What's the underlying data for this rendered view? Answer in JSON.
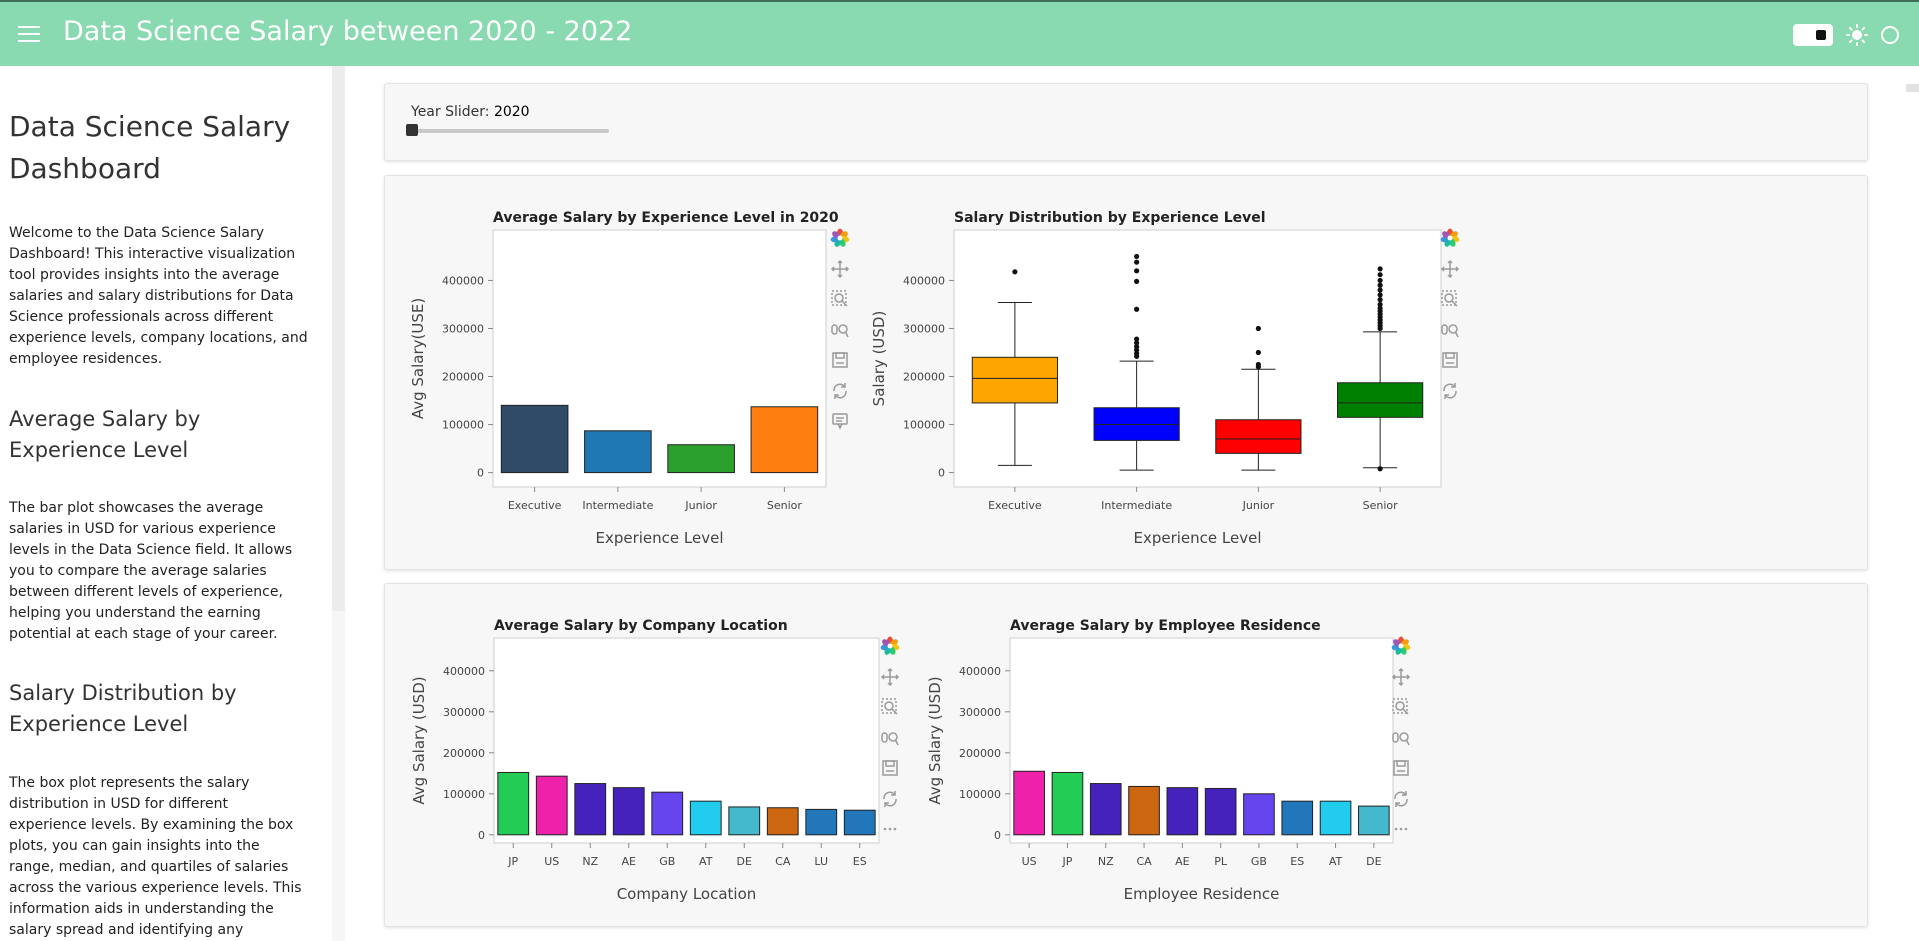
{
  "header": {
    "title": "Data Science Salary between 2020 - 2022",
    "bg_color": "#89dab0",
    "menu_icon": "hamburger-icon",
    "theme_icons": [
      "toggle-icon",
      "sun-icon",
      "circle-icon"
    ]
  },
  "sidebar": {
    "title": "Data Science Salary Dashboard",
    "intro": "Welcome to the Data Science Salary Dashboard! This interactive visualization tool provides insights into the average salaries and salary distributions for Data Science professionals across different experience levels, company locations, and employee residences.",
    "sections": [
      {
        "heading": "Average Salary by Experience Level",
        "text": "The bar plot showcases the average salaries in USD for various experience levels in the Data Science field. It allows you to compare the average salaries between different levels of experience, helping you understand the earning potential at each stage of your career."
      },
      {
        "heading": "Salary Distribution by Experience Level",
        "text": "The box plot represents the salary distribution in USD for different experience levels. By examining the box plots, you can gain insights into the range, median, and quartiles of salaries across the various experience levels. This information aids in understanding the salary spread and identifying any potential outliers."
      }
    ]
  },
  "slider": {
    "label": "Year Slider: ",
    "value": "2020",
    "min": 2020,
    "max": 2022,
    "position_fraction": 0.0
  },
  "toolbar_icons": [
    "bokeh-logo-icon",
    "pan-icon",
    "box-zoom-icon",
    "wheel-zoom-icon",
    "save-icon",
    "reset-icon",
    "hover-icon",
    "more-icon"
  ],
  "chart_data": [
    {
      "type": "bar",
      "title": "Average Salary by Experience Level in 2020",
      "xlabel": "Experience Level",
      "ylabel": "Avg Salary(USE)",
      "categories": [
        "Executive",
        "Intermediate",
        "Junior",
        "Senior"
      ],
      "values": [
        140000,
        87000,
        58000,
        137000
      ],
      "colors": [
        "#2f4b68",
        "#1f77b4",
        "#2ca02c",
        "#ff7f0e"
      ],
      "ylim": [
        -30000,
        505000
      ],
      "yticks": [
        0,
        100000,
        200000,
        300000,
        400000
      ],
      "grid": false
    },
    {
      "type": "box",
      "title": "Salary Distribution by Experience Level",
      "xlabel": "Experience Level",
      "ylabel": "Salary (USD)",
      "categories": [
        "Executive",
        "Intermediate",
        "Junior",
        "Senior"
      ],
      "colors": [
        "#ffa500",
        "#0000ff",
        "#ff0000",
        "#008000"
      ],
      "boxes": [
        {
          "min": 15000,
          "q1": 145000,
          "median": 196000,
          "q3": 240000,
          "max": 354000,
          "outliers": [
            418000
          ]
        },
        {
          "min": 5000,
          "q1": 67000,
          "median": 100000,
          "q3": 135000,
          "max": 232000,
          "outliers": [
            242000,
            248000,
            255000,
            262000,
            270000,
            278000,
            340000,
            398000,
            420000,
            438000,
            450000
          ]
        },
        {
          "min": 5000,
          "q1": 40000,
          "median": 70000,
          "q3": 110000,
          "max": 215000,
          "outliers": [
            220000,
            225000,
            250000,
            300000
          ]
        },
        {
          "min": 10000,
          "q1": 115000,
          "median": 145000,
          "q3": 187000,
          "max": 293000,
          "outliers": [
            8000,
            300000,
            306000,
            312000,
            318000,
            324000,
            330000,
            336000,
            342000,
            350000,
            360000,
            370000,
            380000,
            390000,
            400000,
            412000,
            424000
          ]
        }
      ],
      "ylim": [
        -30000,
        505000
      ],
      "yticks": [
        0,
        100000,
        200000,
        300000,
        400000
      ],
      "grid": false
    },
    {
      "type": "bar",
      "title": "Average Salary by Company Location",
      "xlabel": "Company Location",
      "ylabel": "Avg Salary (USD)",
      "categories": [
        "JP",
        "US",
        "NZ",
        "AE",
        "GB",
        "AT",
        "DE",
        "CA",
        "LU",
        "ES"
      ],
      "values": [
        152000,
        143000,
        125000,
        115000,
        104000,
        82000,
        68000,
        66000,
        62000,
        60000
      ],
      "colors": [
        "#22cc55",
        "#ee22aa",
        "#4422bb",
        "#4422bb",
        "#6644ee",
        "#22ccee",
        "#44b8cc",
        "#cc6611",
        "#2277bb",
        "#2277bb"
      ],
      "ylim": [
        -20000,
        480000
      ],
      "yticks": [
        0,
        100000,
        200000,
        300000,
        400000
      ],
      "grid": false
    },
    {
      "type": "bar",
      "title": "Average Salary by Employee Residence",
      "xlabel": "Employee Residence",
      "ylabel": "Avg Salary (USD)",
      "categories": [
        "US",
        "JP",
        "NZ",
        "CA",
        "AE",
        "PL",
        "GB",
        "ES",
        "AT",
        "DE"
      ],
      "values": [
        155000,
        152000,
        125000,
        118000,
        115000,
        113000,
        100000,
        82000,
        82000,
        70000
      ],
      "colors": [
        "#ee22aa",
        "#22cc55",
        "#4422bb",
        "#cc6611",
        "#4422bb",
        "#4422bb",
        "#6644ee",
        "#2277bb",
        "#22ccee",
        "#44b8cc"
      ],
      "ylim": [
        -20000,
        480000
      ],
      "yticks": [
        0,
        100000,
        200000,
        300000,
        400000
      ],
      "grid": false
    }
  ]
}
